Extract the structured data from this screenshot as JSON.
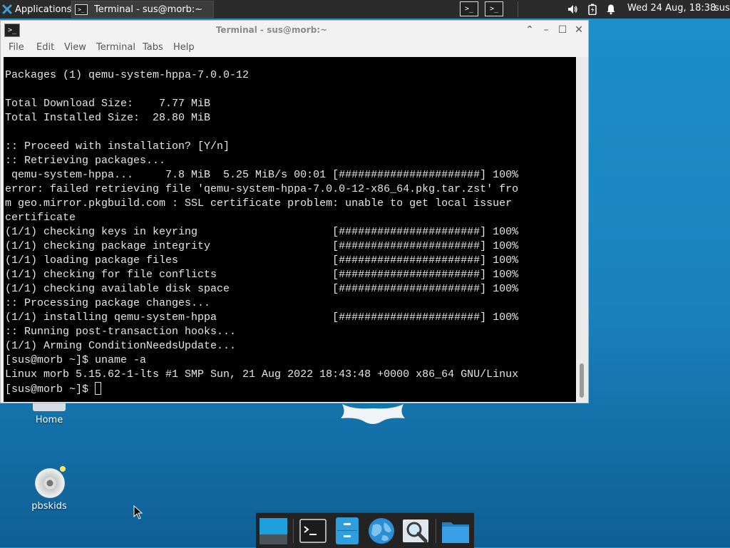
{
  "top_panel": {
    "applications_label": "Applications",
    "task_title": "Terminal - sus@morb:~",
    "clock": "Wed 24 Aug, 18:38",
    "user": "sus"
  },
  "desktop": {
    "icons": [
      {
        "label": "Home"
      },
      {
        "label": "pbskids"
      }
    ]
  },
  "window": {
    "title": "Terminal - sus@morb:~",
    "menu": [
      "File",
      "Edit",
      "View",
      "Terminal",
      "Tabs",
      "Help"
    ]
  },
  "terminal": {
    "lines": [
      "Packages (1) qemu-system-hppa-7.0.0-12",
      "",
      "Total Download Size:    7.77 MiB",
      "Total Installed Size:  28.80 MiB",
      "",
      ":: Proceed with installation? [Y/n]",
      ":: Retrieving packages...",
      " qemu-system-hppa...     7.8 MiB  5.25 MiB/s 00:01 [######################] 100%",
      "error: failed retrieving file 'qemu-system-hppa-7.0.0-12-x86_64.pkg.tar.zst' fro",
      "m geo.mirror.pkgbuild.com : SSL certificate problem: unable to get local issuer",
      "certificate",
      "(1/1) checking keys in keyring                     [######################] 100%",
      "(1/1) checking package integrity                   [######################] 100%",
      "(1/1) loading package files                        [######################] 100%",
      "(1/1) checking for file conflicts                  [######################] 100%",
      "(1/1) checking available disk space                [######################] 100%",
      ":: Processing package changes...",
      "(1/1) installing qemu-system-hppa                  [######################] 100%",
      ":: Running post-transaction hooks...",
      "(1/1) Arming ConditionNeedsUpdate...",
      "[sus@morb ~]$ uname -a",
      "Linux morb 5.15.62-1-lts #1 SMP Sun, 21 Aug 2022 18:43:48 +0000 x86_64 GNU/Linux"
    ],
    "prompt": "[sus@morb ~]$ "
  },
  "icons": {
    "applications": "xfce-mouse-icon",
    "volume": "speaker-icon",
    "battery": "battery-icon",
    "notifications": "bell-icon"
  }
}
